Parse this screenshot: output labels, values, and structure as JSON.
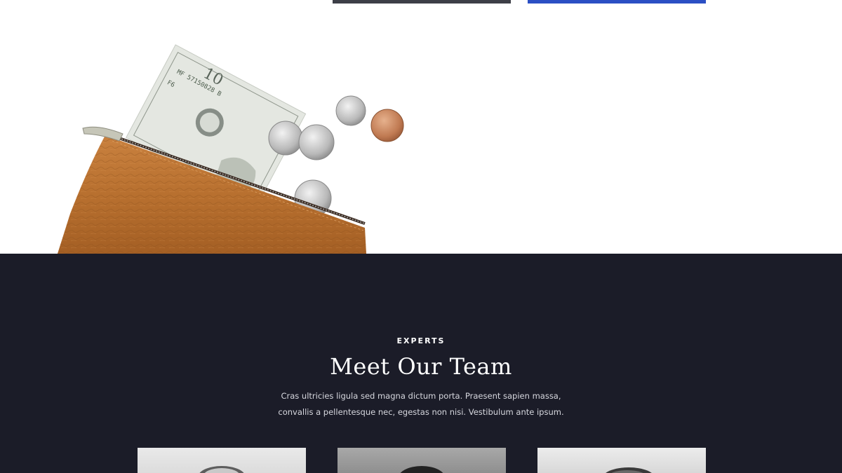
{
  "top_buttons": [
    {
      "name": "secondary-action",
      "color": "#3d3f47"
    },
    {
      "name": "primary-action",
      "color": "#2b4fc4"
    }
  ],
  "hero": {
    "image": "wallet-with-cash-and-coins",
    "banknote_serial": "MF 57150828 B",
    "banknote_code": "F6"
  },
  "team_section": {
    "eyebrow": "EXPERTS",
    "title": "Meet Our Team",
    "description": "Cras ultricies ligula sed magna dictum porta. Praesent sapien massa, convallis a pellentesque nec, egestas non nisi. Vestibulum ante ipsum.",
    "background_color": "#1b1c28",
    "members": [
      {
        "photo": "team-member-photo-1"
      },
      {
        "photo": "team-member-photo-2"
      },
      {
        "photo": "team-member-photo-3"
      }
    ]
  }
}
